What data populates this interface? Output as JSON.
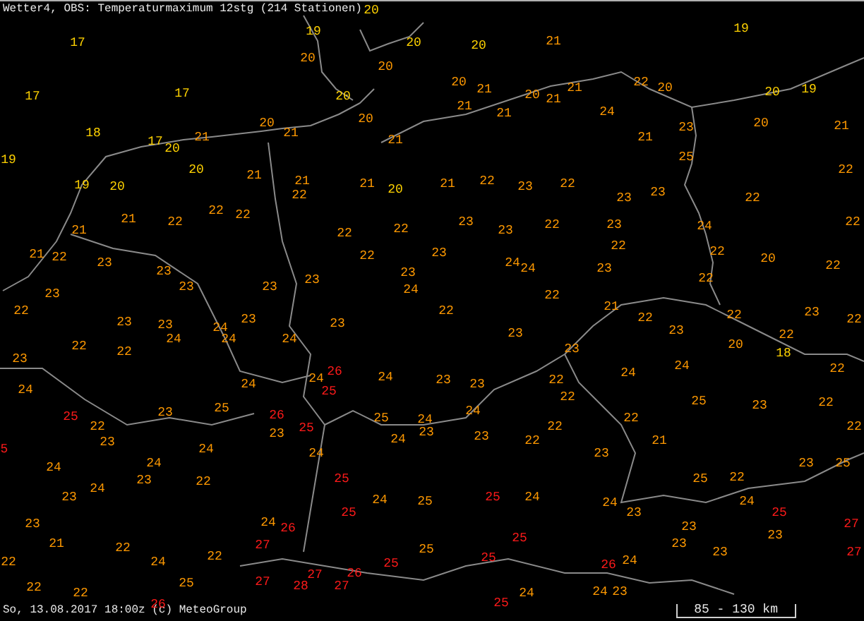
{
  "title": "Wetter4, OBS: Temperaturmaximum 12stg (214 Stationen)",
  "stations": [
    {
      "value": "17",
      "color": "#ffd200"
    },
    {
      "value": "17",
      "color": "#ffd200"
    },
    {
      "value": "17",
      "color": "#ffd200"
    },
    {
      "value": "18",
      "color": "#ffd200"
    },
    {
      "value": "17",
      "color": "#ffd200"
    },
    {
      "value": "21",
      "color": "#ff9900"
    },
    {
      "value": "20",
      "color": "#ffd200"
    },
    {
      "value": "20",
      "color": "#ff9900"
    },
    {
      "value": "21",
      "color": "#ff9900"
    },
    {
      "value": "19",
      "color": "#ffd200"
    },
    {
      "value": "20",
      "color": "#ffd200"
    },
    {
      "value": "21",
      "color": "#ff9900"
    },
    {
      "value": "19",
      "color": "#ffd200"
    },
    {
      "value": "20",
      "color": "#ffd200"
    },
    {
      "value": "22",
      "color": "#ff9900"
    },
    {
      "value": "22",
      "color": "#ff9900"
    },
    {
      "value": "21",
      "color": "#ff9900"
    },
    {
      "value": "22",
      "color": "#ff9900"
    },
    {
      "value": "21",
      "color": "#ff9900"
    },
    {
      "value": "21",
      "color": "#ff9900"
    },
    {
      "value": "22",
      "color": "#ff9900"
    },
    {
      "value": "23",
      "color": "#ff9900"
    },
    {
      "value": "23",
      "color": "#ff9900"
    },
    {
      "value": "23",
      "color": "#ff9900"
    },
    {
      "value": "23",
      "color": "#ff9900"
    },
    {
      "value": "23",
      "color": "#ff9900"
    },
    {
      "value": "22",
      "color": "#ff9900"
    },
    {
      "value": "20",
      "color": "#ffd200"
    },
    {
      "value": "19",
      "color": "#ffd200"
    },
    {
      "value": "20",
      "color": "#ffd200"
    },
    {
      "value": "20",
      "color": "#ffd200"
    },
    {
      "value": "21",
      "color": "#ff9900"
    },
    {
      "value": "20",
      "color": "#ff9900"
    },
    {
      "value": "20",
      "color": "#ff9900"
    },
    {
      "value": "20",
      "color": "#ff9900"
    },
    {
      "value": "21",
      "color": "#ff9900"
    },
    {
      "value": "20",
      "color": "#ff9900"
    },
    {
      "value": "21",
      "color": "#ff9900"
    },
    {
      "value": "21",
      "color": "#ff9900"
    },
    {
      "value": "20",
      "color": "#ffd200"
    },
    {
      "value": "21",
      "color": "#ff9900"
    },
    {
      "value": "21",
      "color": "#ff9900"
    },
    {
      "value": "20",
      "color": "#ff9900"
    },
    {
      "value": "21",
      "color": "#ff9900"
    },
    {
      "value": "21",
      "color": "#ff9900"
    },
    {
      "value": "22",
      "color": "#ff9900"
    },
    {
      "value": "21",
      "color": "#ff9900"
    },
    {
      "value": "20",
      "color": "#ffd200"
    },
    {
      "value": "21",
      "color": "#ff9900"
    },
    {
      "value": "22",
      "color": "#ff9900"
    },
    {
      "value": "23",
      "color": "#ff9900"
    },
    {
      "value": "22",
      "color": "#ff9900"
    },
    {
      "value": "23",
      "color": "#ff9900"
    },
    {
      "value": "22",
      "color": "#ff9900"
    },
    {
      "value": "22",
      "color": "#ff9900"
    },
    {
      "value": "23",
      "color": "#ff9900"
    },
    {
      "value": "22",
      "color": "#ff9900"
    },
    {
      "value": "22",
      "color": "#ff9900"
    },
    {
      "value": "23",
      "color": "#ff9900"
    },
    {
      "value": "24",
      "color": "#ff9900"
    },
    {
      "value": "24",
      "color": "#ff9900"
    },
    {
      "value": "23",
      "color": "#ff9900"
    },
    {
      "value": "23",
      "color": "#ff9900"
    },
    {
      "value": "24",
      "color": "#ff9900"
    },
    {
      "value": "22",
      "color": "#ff9900"
    },
    {
      "value": "22",
      "color": "#ff9900"
    },
    {
      "value": "19",
      "color": "#ffd200"
    },
    {
      "value": "22",
      "color": "#ff9900"
    },
    {
      "value": "20",
      "color": "#ff9900"
    },
    {
      "value": "24",
      "color": "#ff9900"
    },
    {
      "value": "20",
      "color": "#ffd200"
    },
    {
      "value": "19",
      "color": "#ffd200"
    },
    {
      "value": "23",
      "color": "#ff9900"
    },
    {
      "value": "20",
      "color": "#ff9900"
    },
    {
      "value": "21",
      "color": "#ff9900"
    },
    {
      "value": "21",
      "color": "#ff9900"
    },
    {
      "value": "25",
      "color": "#ff9900"
    },
    {
      "value": "22",
      "color": "#ff9900"
    },
    {
      "value": "23",
      "color": "#ff9900"
    },
    {
      "value": "23",
      "color": "#ff9900"
    },
    {
      "value": "22",
      "color": "#ff9900"
    },
    {
      "value": "23",
      "color": "#ff9900"
    },
    {
      "value": "24",
      "color": "#ff9900"
    },
    {
      "value": "22",
      "color": "#ff9900"
    },
    {
      "value": "22",
      "color": "#ff9900"
    },
    {
      "value": "22",
      "color": "#ff9900"
    },
    {
      "value": "20",
      "color": "#ff9900"
    },
    {
      "value": "23",
      "color": "#ff9900"
    },
    {
      "value": "22",
      "color": "#ff9900"
    },
    {
      "value": "22",
      "color": "#ff9900"
    },
    {
      "value": "21",
      "color": "#ff9900"
    },
    {
      "value": "23",
      "color": "#ff9900"
    },
    {
      "value": "23",
      "color": "#ff9900"
    },
    {
      "value": "24",
      "color": "#ff9900"
    },
    {
      "value": "24",
      "color": "#ff9900"
    },
    {
      "value": "23",
      "color": "#ff9900"
    },
    {
      "value": "24",
      "color": "#ff9900"
    },
    {
      "value": "22",
      "color": "#ff9900"
    },
    {
      "value": "22",
      "color": "#ff9900"
    },
    {
      "value": "23",
      "color": "#ff9900"
    },
    {
      "value": "24",
      "color": "#ff9900"
    },
    {
      "value": "24",
      "color": "#ff9900"
    },
    {
      "value": "25",
      "color": "#ff9900"
    },
    {
      "value": "23",
      "color": "#ff9900"
    },
    {
      "value": "25",
      "color": "#ff1a1a"
    },
    {
      "value": "26",
      "color": "#ff1a1a"
    },
    {
      "value": "22",
      "color": "#ff9900"
    },
    {
      "value": "23",
      "color": "#ff9900"
    },
    {
      "value": "23",
      "color": "#ff9900"
    },
    {
      "value": "5",
      "color": "#ff1a1a"
    },
    {
      "value": "24",
      "color": "#ff9900"
    },
    {
      "value": "24",
      "color": "#ff9900"
    },
    {
      "value": "24",
      "color": "#ff9900"
    },
    {
      "value": "23",
      "color": "#ff9900"
    },
    {
      "value": "22",
      "color": "#ff9900"
    },
    {
      "value": "24",
      "color": "#ff9900"
    },
    {
      "value": "23",
      "color": "#ff9900"
    },
    {
      "value": "23",
      "color": "#ff9900"
    },
    {
      "value": "24",
      "color": "#ff9900"
    },
    {
      "value": "26",
      "color": "#ff1a1a"
    },
    {
      "value": "21",
      "color": "#ff9900"
    },
    {
      "value": "22",
      "color": "#ff9900"
    },
    {
      "value": "27",
      "color": "#ff1a1a"
    },
    {
      "value": "22",
      "color": "#ff9900"
    },
    {
      "value": "24",
      "color": "#ff9900"
    },
    {
      "value": "22",
      "color": "#ff9900"
    },
    {
      "value": "22",
      "color": "#ff9900"
    },
    {
      "value": "25",
      "color": "#ff9900"
    },
    {
      "value": "27",
      "color": "#ff1a1a"
    },
    {
      "value": "22",
      "color": "#ff9900"
    },
    {
      "value": "26",
      "color": "#ff1a1a"
    },
    {
      "value": "23",
      "color": "#ff9900"
    },
    {
      "value": "24",
      "color": "#ff9900"
    },
    {
      "value": "23",
      "color": "#ff9900"
    },
    {
      "value": "23",
      "color": "#ff9900"
    },
    {
      "value": "24",
      "color": "#ff9900"
    },
    {
      "value": "26",
      "color": "#ff1a1a"
    },
    {
      "value": "25",
      "color": "#ff1a1a"
    },
    {
      "value": "24",
      "color": "#ff9900"
    },
    {
      "value": "23",
      "color": "#ff9900"
    },
    {
      "value": "23",
      "color": "#ff9900"
    },
    {
      "value": "22",
      "color": "#ff9900"
    },
    {
      "value": "22",
      "color": "#ff9900"
    },
    {
      "value": "25",
      "color": "#ff9900"
    },
    {
      "value": "24",
      "color": "#ff9900"
    },
    {
      "value": "23",
      "color": "#ff9900"
    },
    {
      "value": "24",
      "color": "#ff9900"
    },
    {
      "value": "25",
      "color": "#ff1a1a"
    },
    {
      "value": "24",
      "color": "#ff9900"
    },
    {
      "value": "23",
      "color": "#ff9900"
    },
    {
      "value": "22",
      "color": "#ff9900"
    },
    {
      "value": "22",
      "color": "#ff9900"
    },
    {
      "value": "24",
      "color": "#ff9900"
    },
    {
      "value": "25",
      "color": "#ff1a1a"
    },
    {
      "value": "24",
      "color": "#ff9900"
    },
    {
      "value": "25",
      "color": "#ff9900"
    },
    {
      "value": "25",
      "color": "#ff1a1a"
    },
    {
      "value": "24",
      "color": "#ff9900"
    },
    {
      "value": "25",
      "color": "#ff1a1a"
    },
    {
      "value": "25",
      "color": "#ff1a1a"
    },
    {
      "value": "25",
      "color": "#ff9900"
    },
    {
      "value": "25",
      "color": "#ff1a1a"
    },
    {
      "value": "25",
      "color": "#ff1a1a"
    },
    {
      "value": "27",
      "color": "#ff1a1a"
    },
    {
      "value": "26",
      "color": "#ff1a1a"
    },
    {
      "value": "28",
      "color": "#ff1a1a"
    },
    {
      "value": "27",
      "color": "#ff1a1a"
    },
    {
      "value": "24",
      "color": "#ff9900"
    },
    {
      "value": "25",
      "color": "#ff1a1a"
    },
    {
      "value": "22",
      "color": "#ff9900"
    },
    {
      "value": "22",
      "color": "#ff9900"
    },
    {
      "value": "23",
      "color": "#ff9900"
    },
    {
      "value": "22",
      "color": "#ff9900"
    },
    {
      "value": "23",
      "color": "#ff9900"
    },
    {
      "value": "22",
      "color": "#ff9900"
    },
    {
      "value": "20",
      "color": "#ff9900"
    },
    {
      "value": "18",
      "color": "#ffd200"
    },
    {
      "value": "24",
      "color": "#ff9900"
    },
    {
      "value": "24",
      "color": "#ff9900"
    },
    {
      "value": "22",
      "color": "#ff9900"
    },
    {
      "value": "25",
      "color": "#ff9900"
    },
    {
      "value": "23",
      "color": "#ff9900"
    },
    {
      "value": "22",
      "color": "#ff9900"
    },
    {
      "value": "22",
      "color": "#ff9900"
    },
    {
      "value": "22",
      "color": "#ff9900"
    },
    {
      "value": "21",
      "color": "#ff9900"
    },
    {
      "value": "23",
      "color": "#ff9900"
    },
    {
      "value": "23",
      "color": "#ff9900"
    },
    {
      "value": "25",
      "color": "#ff9900"
    },
    {
      "value": "25",
      "color": "#ff9900"
    },
    {
      "value": "22",
      "color": "#ff9900"
    },
    {
      "value": "24",
      "color": "#ff9900"
    },
    {
      "value": "23",
      "color": "#ff9900"
    },
    {
      "value": "24",
      "color": "#ff9900"
    },
    {
      "value": "25",
      "color": "#ff1a1a"
    },
    {
      "value": "23",
      "color": "#ff9900"
    },
    {
      "value": "27",
      "color": "#ff1a1a"
    },
    {
      "value": "23",
      "color": "#ff9900"
    },
    {
      "value": "23",
      "color": "#ff9900"
    },
    {
      "value": "23",
      "color": "#ff9900"
    },
    {
      "value": "27",
      "color": "#ff1a1a"
    },
    {
      "value": "26",
      "color": "#ff1a1a"
    },
    {
      "value": "24",
      "color": "#ff9900"
    },
    {
      "value": "24",
      "color": "#ff9900"
    },
    {
      "value": "23",
      "color": "#ff9900"
    }
  ],
  "footer": "So, 13.08.2017 18:00z (c) MeteoGroup",
  "scale_label": "85 - 130 km"
}
